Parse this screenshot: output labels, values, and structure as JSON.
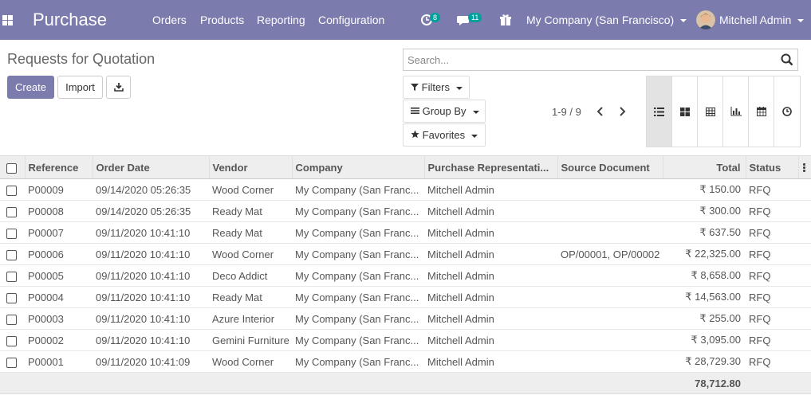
{
  "navbar": {
    "brand": "Purchase",
    "menus": [
      "Orders",
      "Products",
      "Reporting",
      "Configuration"
    ],
    "activity_count": "8",
    "message_count": "11",
    "company": "My Company (San Francisco)",
    "user": "Mitchell Admin",
    "colors": {
      "bar": "#7c7bad",
      "badge": "#00a09d"
    }
  },
  "control": {
    "title": "Requests for Quotation",
    "create_label": "Create",
    "import_label": "Import",
    "search_placeholder": "Search...",
    "filters_label": "Filters",
    "groupby_label": "Group By",
    "favorites_label": "Favorites",
    "pager": "1-9 / 9",
    "views": [
      "list-view-icon",
      "kanban-view-icon",
      "pivot-view-icon",
      "graph-view-icon",
      "calendar-view-icon",
      "activity-view-icon"
    ],
    "active_view": "list-view-icon"
  },
  "table": {
    "columns": [
      "Reference",
      "Order Date",
      "Vendor",
      "Company",
      "Purchase Representati...",
      "Source Document",
      "Total",
      "Status"
    ],
    "rows": [
      [
        "P00009",
        "09/14/2020 05:26:35",
        "Wood Corner",
        "My Company (San Franc...",
        "Mitchell Admin",
        "",
        "₹ 150.00",
        "RFQ"
      ],
      [
        "P00008",
        "09/14/2020 05:26:35",
        "Ready Mat",
        "My Company (San Franc...",
        "Mitchell Admin",
        "",
        "₹ 300.00",
        "RFQ"
      ],
      [
        "P00007",
        "09/11/2020 10:41:10",
        "Ready Mat",
        "My Company (San Franc...",
        "Mitchell Admin",
        "",
        "₹ 637.50",
        "RFQ"
      ],
      [
        "P00006",
        "09/11/2020 10:41:10",
        "Wood Corner",
        "My Company (San Franc...",
        "Mitchell Admin",
        "OP/00001, OP/00002",
        "₹ 22,325.00",
        "RFQ"
      ],
      [
        "P00005",
        "09/11/2020 10:41:10",
        "Deco Addict",
        "My Company (San Franc...",
        "Mitchell Admin",
        "",
        "₹ 8,658.00",
        "RFQ"
      ],
      [
        "P00004",
        "09/11/2020 10:41:10",
        "Ready Mat",
        "My Company (San Franc...",
        "Mitchell Admin",
        "",
        "₹ 14,563.00",
        "RFQ"
      ],
      [
        "P00003",
        "09/11/2020 10:41:10",
        "Azure Interior",
        "My Company (San Franc...",
        "Mitchell Admin",
        "",
        "₹ 255.00",
        "RFQ"
      ],
      [
        "P00002",
        "09/11/2020 10:41:10",
        "Gemini Furniture",
        "My Company (San Franc...",
        "Mitchell Admin",
        "",
        "₹ 3,095.00",
        "RFQ"
      ],
      [
        "P00001",
        "09/11/2020 10:41:09",
        "Wood Corner",
        "My Company (San Franc...",
        "Mitchell Admin",
        "",
        "₹ 28,729.30",
        "RFQ"
      ]
    ],
    "total": "78,712.80"
  }
}
